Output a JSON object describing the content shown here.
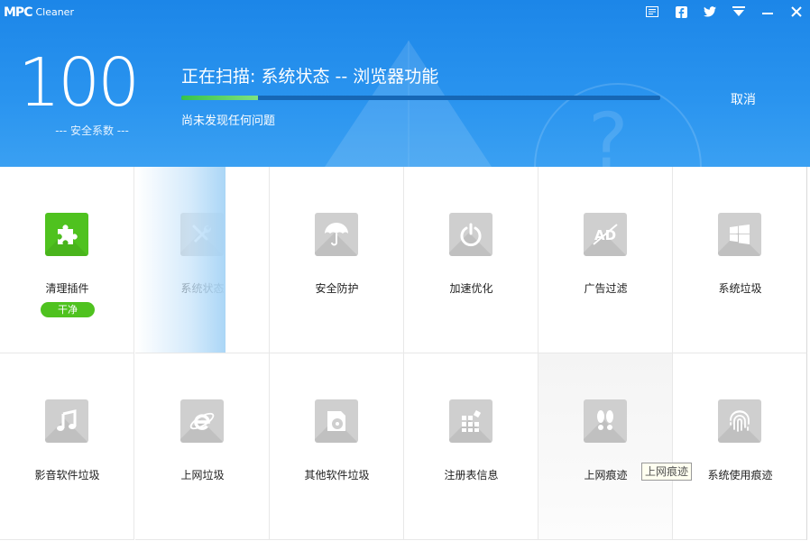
{
  "app": {
    "logo_mark": "MPC",
    "logo_text": "Cleaner"
  },
  "window_controls": [
    {
      "name": "menu-icon"
    },
    {
      "name": "facebook-icon"
    },
    {
      "name": "twitter-icon"
    },
    {
      "name": "dropdown-icon"
    },
    {
      "name": "minimize-icon"
    },
    {
      "name": "close-icon"
    }
  ],
  "header": {
    "score": "100",
    "score_label": "--- 安全系数 ---",
    "scan_title": "正在扫描: 系统状态 -- 浏览器功能",
    "progress_fraction": 0.16,
    "scan_status": "尚未发现任何问题",
    "cancel_label": "取消"
  },
  "colors": {
    "accent": "#2a94ef",
    "green": "#4fc21f",
    "icon_gray": "#cfcfcf"
  },
  "grid": {
    "row1": [
      {
        "label": "清理插件",
        "icon": "puzzle-icon",
        "badge": "干净",
        "green": true
      },
      {
        "label": "系统状态",
        "icon": "tools-icon"
      },
      {
        "label": "安全防护",
        "icon": "umbrella-icon"
      },
      {
        "label": "加速优化",
        "icon": "power-icon"
      },
      {
        "label": "广告过滤",
        "icon": "ad-block-icon"
      },
      {
        "label": "系统垃圾",
        "icon": "windows-icon"
      }
    ],
    "row2": [
      {
        "label": "影音软件垃圾",
        "icon": "music-icon"
      },
      {
        "label": "上网垃圾",
        "icon": "ie-icon"
      },
      {
        "label": "其他软件垃圾",
        "icon": "disc-icon"
      },
      {
        "label": "注册表信息",
        "icon": "registry-icon"
      },
      {
        "label": "上网痕迹",
        "icon": "footprints-icon"
      },
      {
        "label": "系统使用痕迹",
        "icon": "fingerprint-icon"
      }
    ]
  },
  "tooltip": "上网痕迹"
}
